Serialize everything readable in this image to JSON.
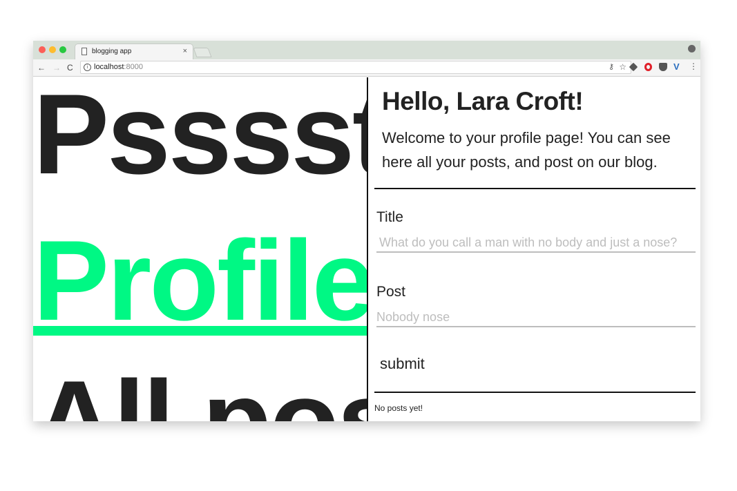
{
  "browser": {
    "tab_title": "blogging app",
    "tab_close": "×",
    "url_host": "localhost",
    "url_port": ":8000",
    "nav_back": "←",
    "nav_forward": "→",
    "nav_reload": "C",
    "extension_v": "V",
    "menu": "⋮"
  },
  "left": {
    "headline1": "Psssst",
    "headline2": "Profile",
    "headline3": "All posts"
  },
  "profile": {
    "greeting": "Hello, Lara Croft!",
    "intro": "Welcome to your profile page! You can see here all your posts, and post on our blog."
  },
  "form": {
    "title_label": "Title",
    "title_placeholder": "What do you call a man with no body and just a nose?",
    "post_label": "Post",
    "post_placeholder": "Nobody nose",
    "submit_label": "submit"
  },
  "posts": {
    "empty_message": "No posts yet!"
  },
  "colors": {
    "accent": "#00f884",
    "text": "#222222",
    "divider": "#111111"
  }
}
